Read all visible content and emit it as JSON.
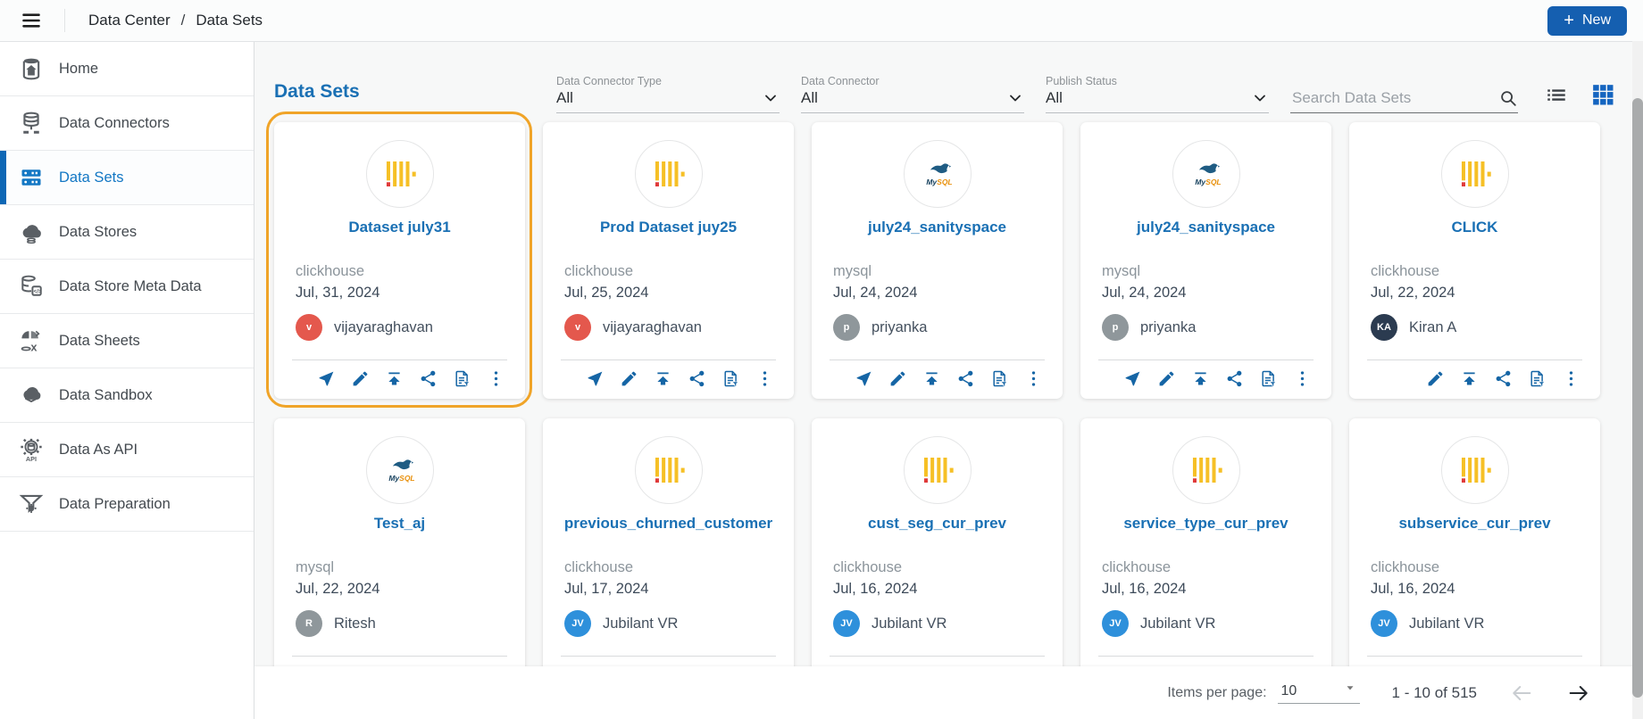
{
  "topbar": {
    "breadcrumb_1": "Data Center",
    "breadcrumb_sep": "/",
    "breadcrumb_2": "Data Sets",
    "new_button": {
      "plus": "+",
      "label": "New"
    }
  },
  "sidebar": {
    "active_index": 2,
    "items": [
      {
        "label": "Home",
        "slug": "home",
        "icon": "home-database"
      },
      {
        "label": "Data Connectors",
        "slug": "data-connectors",
        "icon": "data-connectors"
      },
      {
        "label": "Data Sets",
        "slug": "data-sets",
        "icon": "data-sets"
      },
      {
        "label": "Data Stores",
        "slug": "data-stores",
        "icon": "data-stores"
      },
      {
        "label": "Data Store Meta Data",
        "slug": "data-store-meta-data",
        "icon": "data-store-meta-data"
      },
      {
        "label": "Data Sheets",
        "slug": "data-sheets",
        "icon": "data-sheets"
      },
      {
        "label": "Data Sandbox",
        "slug": "data-sandbox",
        "icon": "data-sandbox"
      },
      {
        "label": "Data As API",
        "slug": "data-as-api",
        "icon": "data-as-api"
      },
      {
        "label": "Data Preparation",
        "slug": "data-preparation",
        "icon": "data-preparation"
      }
    ]
  },
  "main": {
    "title": "Data Sets",
    "filters": [
      {
        "label": "Data Connector Type",
        "value": "All",
        "slug": "data-connector-type"
      },
      {
        "label": "Data Connector",
        "value": "All",
        "slug": "data-connector"
      },
      {
        "label": "Publish Status",
        "value": "All",
        "slug": "publish-status"
      }
    ],
    "search": {
      "placeholder": "Search Data Sets"
    },
    "logos": {
      "mysql_label": "MySQL"
    },
    "cards": [
      {
        "name": "Dataset july31",
        "connector": "clickhouse",
        "date": "Jul, 31, 2024",
        "owner": "vijayaraghavan",
        "initials": "v",
        "avatar_color": "#E4584D",
        "logo": "clickhouse",
        "highlighted": true,
        "send": true
      },
      {
        "name": "Prod Dataset juy25",
        "connector": "clickhouse",
        "date": "Jul, 25, 2024",
        "owner": "vijayaraghavan",
        "initials": "v",
        "avatar_color": "#E4584D",
        "logo": "clickhouse",
        "highlighted": false,
        "send": true
      },
      {
        "name": "july24_sanityspace",
        "connector": "mysql",
        "date": "Jul, 24, 2024",
        "owner": "priyanka",
        "initials": "p",
        "avatar_color": "#8F979B",
        "logo": "mysql",
        "highlighted": false,
        "send": true
      },
      {
        "name": "july24_sanityspace",
        "connector": "mysql",
        "date": "Jul, 24, 2024",
        "owner": "priyanka",
        "initials": "p",
        "avatar_color": "#8F979B",
        "logo": "mysql",
        "highlighted": false,
        "send": true
      },
      {
        "name": "CLICK",
        "connector": "clickhouse",
        "date": "Jul, 22, 2024",
        "owner": "Kiran A",
        "initials": "KA",
        "avatar_color": "#2B3B50",
        "logo": "clickhouse",
        "highlighted": false,
        "send": false
      },
      {
        "name": "Test_aj",
        "connector": "mysql",
        "date": "Jul, 22, 2024",
        "owner": "Ritesh",
        "initials": "R",
        "avatar_color": "#8F979B",
        "logo": "mysql",
        "highlighted": false,
        "send": false
      },
      {
        "name": "previous_churned_customer",
        "connector": "clickhouse",
        "date": "Jul, 17, 2024",
        "owner": "Jubilant VR",
        "initials": "JV",
        "avatar_color": "#2E90DB",
        "logo": "clickhouse",
        "highlighted": false,
        "send": true
      },
      {
        "name": "cust_seg_cur_prev",
        "connector": "clickhouse",
        "date": "Jul, 16, 2024",
        "owner": "Jubilant VR",
        "initials": "JV",
        "avatar_color": "#2E90DB",
        "logo": "clickhouse",
        "highlighted": false,
        "send": true
      },
      {
        "name": "service_type_cur_prev",
        "connector": "clickhouse",
        "date": "Jul, 16, 2024",
        "owner": "Jubilant VR",
        "initials": "JV",
        "avatar_color": "#2E90DB",
        "logo": "clickhouse",
        "highlighted": false,
        "send": true
      },
      {
        "name": "subservice_cur_prev",
        "connector": "clickhouse",
        "date": "Jul, 16, 2024",
        "owner": "Jubilant VR",
        "initials": "JV",
        "avatar_color": "#2E90DB",
        "logo": "clickhouse",
        "highlighted": false,
        "send": true
      }
    ],
    "pagination": {
      "items_per_page_label": "Items per page:",
      "items_per_page_value": "10",
      "range_text": "1 - 10 of 515"
    }
  },
  "colors": {
    "accent_blue": "#155FB0",
    "link_blue": "#1A70B4",
    "sidebar_active_blue": "#1377C4",
    "action_icon_blue": "#1565A5",
    "highlight_orange": "#F0A428",
    "clickhouse_yellow": "#F6C026",
    "clickhouse_red": "#E03A3A"
  }
}
